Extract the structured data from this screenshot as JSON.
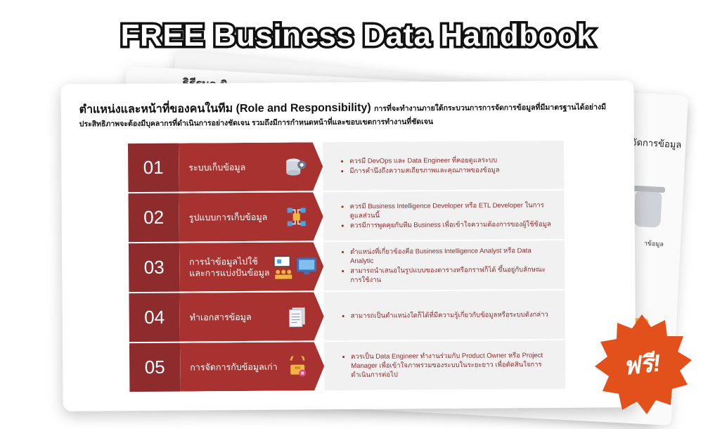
{
  "headline": "FREE Business Data Handbook",
  "back_page": {
    "title": "ธิธีรมด ขิ",
    "right_title": "รจัดการข้อมูล",
    "caption": "าข้อมูล"
  },
  "front_page": {
    "title_main": "ตำแหน่งและหน้าที่ของคนในทีม (Role and Responsibility)",
    "title_rest": "การที่จะทำงานภายใต้กระบวนการการจัดการข้อมูลที่มีมาตรฐานได้อย่างมีประสิทธิภาพจะต้องมีบุคลากรที่ดำเนินการอย่างชัดเจน รวมถึงมีการกำหนดหน้าที่และขอบเขตการทำงานที่ชัดเจน",
    "rows": [
      {
        "number": "01",
        "label": "ระบบเก็บข้อมูล",
        "icon": "database-gear-icon",
        "bullets": [
          "ควรมี DevOps และ Data Engineer ที่คอยดูแลระบบ",
          "มีการคำนึงถึงความสเถียรภาพและคุณภาพของข้อมูล"
        ]
      },
      {
        "number": "02",
        "label": "รูปแบบการเก็บข้อมูล",
        "icon": "data-structure-icon",
        "bullets": [
          "ควรมี Business Intelligence Developer หรือ ETL Developer ในการดูแลส่วนนี้",
          "ควรมีการพูดคุยกับทีม Business เพื่อเข้าใจความต้องการของผู้ใช้ข้อมูล"
        ]
      },
      {
        "number": "03",
        "label": "การนำข้อมูลไปใช้และการแบ่งปันข้อมูล",
        "icon": "presentation-icon",
        "bullets": [
          "ตำแหน่งที่เกี่ยวข้องคือ Business Intelligence Analyst หรือ Data Analytic",
          "สามารถนำเสนอในรูปแบบของตารางหรือกราฟก็ได้ ขึ้นอยู่กับลักษณะการใช้งาน"
        ]
      },
      {
        "number": "04",
        "label": "ทำเอกสารข้อมูล",
        "icon": "document-icon",
        "bullets": [
          "สามารถเป็นตำแหน่งใดก็ได้ที่มีความรู้เกี่ยวกับข้อมูลหรือระบบดังกล่าว"
        ]
      },
      {
        "number": "05",
        "label": "การจัดการกับข้อมูลเก่า",
        "icon": "archive-box-icon",
        "bullets": [
          "ควรเป็น Data Engineer ทำงานร่วมกับ Product Owner หรือ Project Manager เพื่อเข้าใจภาพรวมของระบบในระยะยาว เพื่อตัดสินใจการดำเนินการต่อไป"
        ]
      }
    ]
  },
  "badge": {
    "text": "ฟรี!",
    "color": "#e2511c"
  },
  "colors": {
    "number_bg": "#8e2b2d",
    "label_bg": "#a8322f",
    "desc_bg": "#f1f1f1",
    "bullet_text": "#8e2b2d"
  }
}
